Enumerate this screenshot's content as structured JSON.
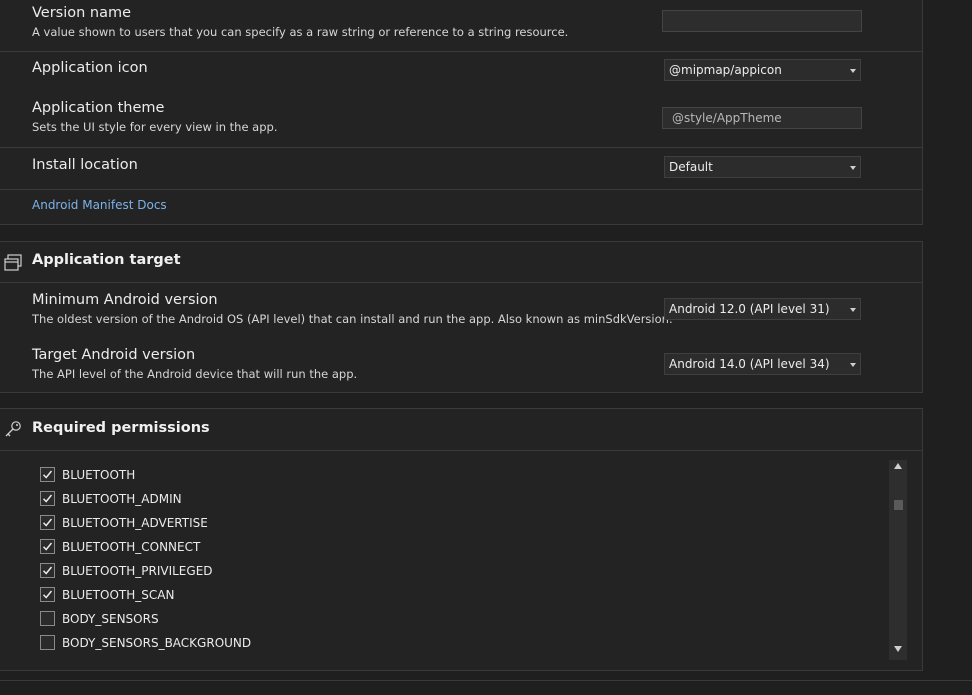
{
  "general": {
    "version_name": {
      "title": "Version name",
      "description": "A value shown to users that you can specify as a raw string or reference to a string resource.",
      "value": ""
    },
    "application_icon": {
      "title": "Application icon",
      "value": "@mipmap/appicon"
    },
    "application_theme": {
      "title": "Application theme",
      "description": "Sets the UI style for every view in the app.",
      "placeholder": "@style/AppTheme"
    },
    "install_location": {
      "title": "Install location",
      "value": "Default"
    },
    "docs_link": "Android Manifest Docs"
  },
  "application_target": {
    "section_title": "Application target",
    "section_icon": "window-stack-icon",
    "min_version": {
      "title": "Minimum Android version",
      "description": "The oldest version of the Android OS (API level) that can install and run the app. Also known as minSdkVersion.",
      "value": "Android 12.0 (API level 31)"
    },
    "target_version": {
      "title": "Target Android version",
      "description": "The API level of the Android device that will run the app.",
      "value": "Android 14.0 (API level 34)"
    }
  },
  "permissions": {
    "section_title": "Required permissions",
    "section_icon": "key-icon",
    "items": [
      {
        "label": "BLUETOOTH",
        "checked": true
      },
      {
        "label": "BLUETOOTH_ADMIN",
        "checked": true
      },
      {
        "label": "BLUETOOTH_ADVERTISE",
        "checked": true
      },
      {
        "label": "BLUETOOTH_CONNECT",
        "checked": true
      },
      {
        "label": "BLUETOOTH_PRIVILEGED",
        "checked": true
      },
      {
        "label": "BLUETOOTH_SCAN",
        "checked": true
      },
      {
        "label": "BODY_SENSORS",
        "checked": false
      },
      {
        "label": "BODY_SENSORS_BACKGROUND",
        "checked": false
      }
    ]
  }
}
